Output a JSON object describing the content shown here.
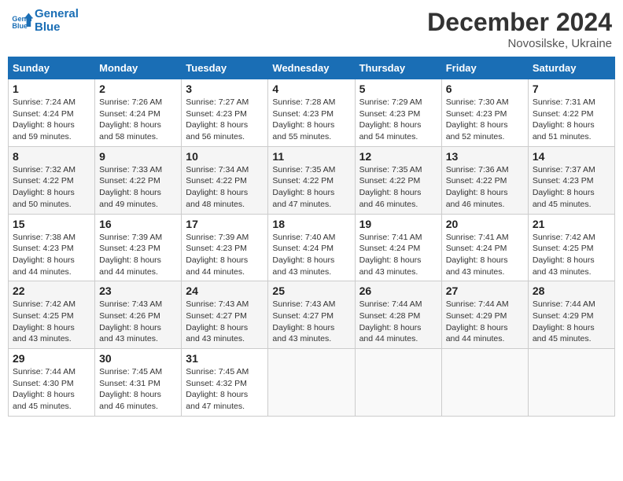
{
  "header": {
    "logo_line1": "General",
    "logo_line2": "Blue",
    "month": "December 2024",
    "location": "Novosilske, Ukraine"
  },
  "weekdays": [
    "Sunday",
    "Monday",
    "Tuesday",
    "Wednesday",
    "Thursday",
    "Friday",
    "Saturday"
  ],
  "weeks": [
    [
      {
        "day": "1",
        "sunrise": "7:24 AM",
        "sunset": "4:24 PM",
        "daylight": "8 hours and 59 minutes."
      },
      {
        "day": "2",
        "sunrise": "7:26 AM",
        "sunset": "4:24 PM",
        "daylight": "8 hours and 58 minutes."
      },
      {
        "day": "3",
        "sunrise": "7:27 AM",
        "sunset": "4:23 PM",
        "daylight": "8 hours and 56 minutes."
      },
      {
        "day": "4",
        "sunrise": "7:28 AM",
        "sunset": "4:23 PM",
        "daylight": "8 hours and 55 minutes."
      },
      {
        "day": "5",
        "sunrise": "7:29 AM",
        "sunset": "4:23 PM",
        "daylight": "8 hours and 54 minutes."
      },
      {
        "day": "6",
        "sunrise": "7:30 AM",
        "sunset": "4:23 PM",
        "daylight": "8 hours and 52 minutes."
      },
      {
        "day": "7",
        "sunrise": "7:31 AM",
        "sunset": "4:22 PM",
        "daylight": "8 hours and 51 minutes."
      }
    ],
    [
      {
        "day": "8",
        "sunrise": "7:32 AM",
        "sunset": "4:22 PM",
        "daylight": "8 hours and 50 minutes."
      },
      {
        "day": "9",
        "sunrise": "7:33 AM",
        "sunset": "4:22 PM",
        "daylight": "8 hours and 49 minutes."
      },
      {
        "day": "10",
        "sunrise": "7:34 AM",
        "sunset": "4:22 PM",
        "daylight": "8 hours and 48 minutes."
      },
      {
        "day": "11",
        "sunrise": "7:35 AM",
        "sunset": "4:22 PM",
        "daylight": "8 hours and 47 minutes."
      },
      {
        "day": "12",
        "sunrise": "7:35 AM",
        "sunset": "4:22 PM",
        "daylight": "8 hours and 46 minutes."
      },
      {
        "day": "13",
        "sunrise": "7:36 AM",
        "sunset": "4:22 PM",
        "daylight": "8 hours and 46 minutes."
      },
      {
        "day": "14",
        "sunrise": "7:37 AM",
        "sunset": "4:23 PM",
        "daylight": "8 hours and 45 minutes."
      }
    ],
    [
      {
        "day": "15",
        "sunrise": "7:38 AM",
        "sunset": "4:23 PM",
        "daylight": "8 hours and 44 minutes."
      },
      {
        "day": "16",
        "sunrise": "7:39 AM",
        "sunset": "4:23 PM",
        "daylight": "8 hours and 44 minutes."
      },
      {
        "day": "17",
        "sunrise": "7:39 AM",
        "sunset": "4:23 PM",
        "daylight": "8 hours and 44 minutes."
      },
      {
        "day": "18",
        "sunrise": "7:40 AM",
        "sunset": "4:24 PM",
        "daylight": "8 hours and 43 minutes."
      },
      {
        "day": "19",
        "sunrise": "7:41 AM",
        "sunset": "4:24 PM",
        "daylight": "8 hours and 43 minutes."
      },
      {
        "day": "20",
        "sunrise": "7:41 AM",
        "sunset": "4:24 PM",
        "daylight": "8 hours and 43 minutes."
      },
      {
        "day": "21",
        "sunrise": "7:42 AM",
        "sunset": "4:25 PM",
        "daylight": "8 hours and 43 minutes."
      }
    ],
    [
      {
        "day": "22",
        "sunrise": "7:42 AM",
        "sunset": "4:25 PM",
        "daylight": "8 hours and 43 minutes."
      },
      {
        "day": "23",
        "sunrise": "7:43 AM",
        "sunset": "4:26 PM",
        "daylight": "8 hours and 43 minutes."
      },
      {
        "day": "24",
        "sunrise": "7:43 AM",
        "sunset": "4:27 PM",
        "daylight": "8 hours and 43 minutes."
      },
      {
        "day": "25",
        "sunrise": "7:43 AM",
        "sunset": "4:27 PM",
        "daylight": "8 hours and 43 minutes."
      },
      {
        "day": "26",
        "sunrise": "7:44 AM",
        "sunset": "4:28 PM",
        "daylight": "8 hours and 44 minutes."
      },
      {
        "day": "27",
        "sunrise": "7:44 AM",
        "sunset": "4:29 PM",
        "daylight": "8 hours and 44 minutes."
      },
      {
        "day": "28",
        "sunrise": "7:44 AM",
        "sunset": "4:29 PM",
        "daylight": "8 hours and 45 minutes."
      }
    ],
    [
      {
        "day": "29",
        "sunrise": "7:44 AM",
        "sunset": "4:30 PM",
        "daylight": "8 hours and 45 minutes."
      },
      {
        "day": "30",
        "sunrise": "7:45 AM",
        "sunset": "4:31 PM",
        "daylight": "8 hours and 46 minutes."
      },
      {
        "day": "31",
        "sunrise": "7:45 AM",
        "sunset": "4:32 PM",
        "daylight": "8 hours and 47 minutes."
      },
      null,
      null,
      null,
      null
    ]
  ],
  "labels": {
    "sunrise": "Sunrise:",
    "sunset": "Sunset:",
    "daylight": "Daylight:"
  }
}
